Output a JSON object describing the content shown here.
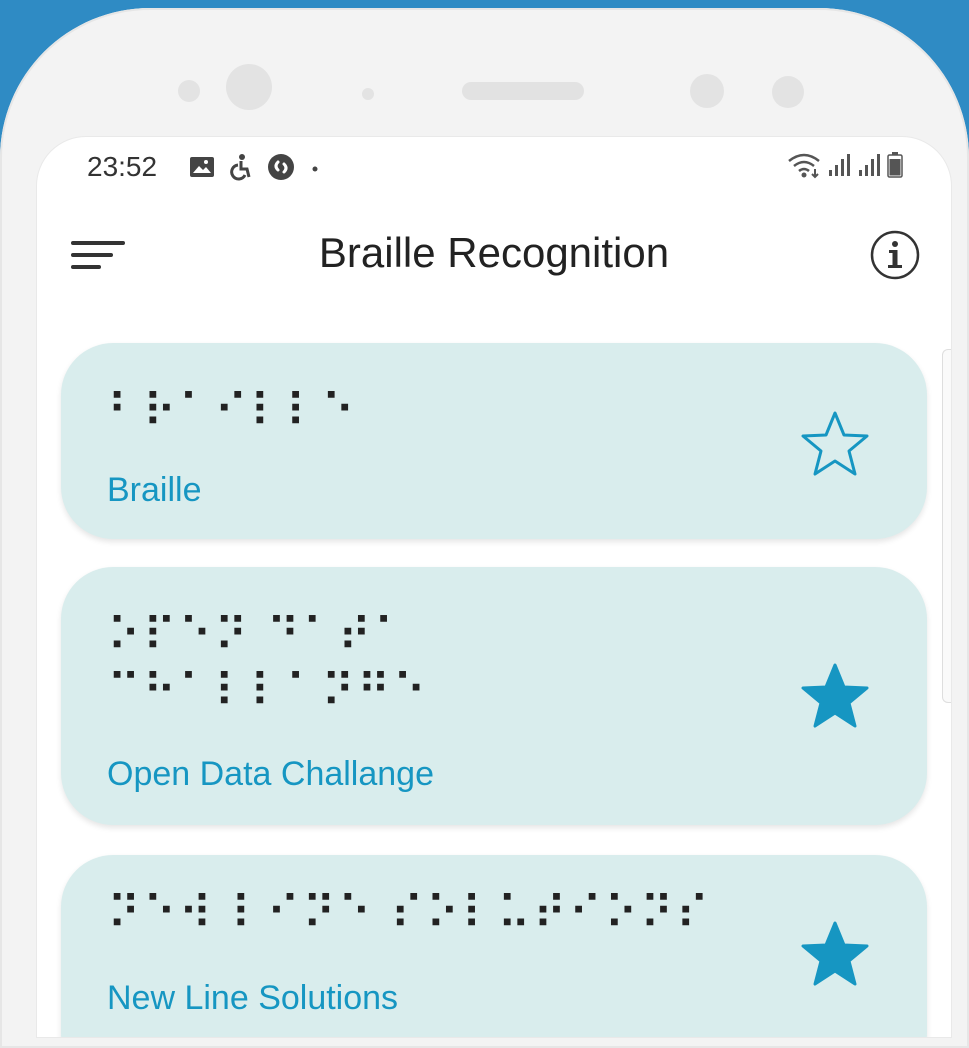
{
  "status_bar": {
    "time": "23:52",
    "icons_left": [
      "image-icon",
      "accessibility-icon",
      "shazam-icon",
      "dot-icon"
    ],
    "icons_right": [
      "wifi-icon",
      "signal-icon",
      "signal-icon",
      "battery-icon"
    ]
  },
  "app_bar": {
    "title": "Braille Recognition",
    "menu_icon": "menu-icon",
    "info_icon": "info-icon"
  },
  "colors": {
    "background": "#2f8bc4",
    "card": "#d9eded",
    "accent": "#1696c2"
  },
  "items": [
    {
      "braille": "⠃⠗⠁⠊⠇⠇⠑",
      "label": "Braille",
      "favorite": false
    },
    {
      "braille": "⠕⠏⠑⠝ ⠙⠁⠞⠁\n⠉⠓⠁⠇⠇⠁⠝⠛⠑",
      "label": "Open Data Challange",
      "favorite": true
    },
    {
      "braille": "⠝⠑⠺ ⠇⠊⠝⠑ ⠎⠕⠇⠥⠞⠊⠕⠝⠎",
      "label": "New Line Solutions",
      "favorite": true
    }
  ]
}
